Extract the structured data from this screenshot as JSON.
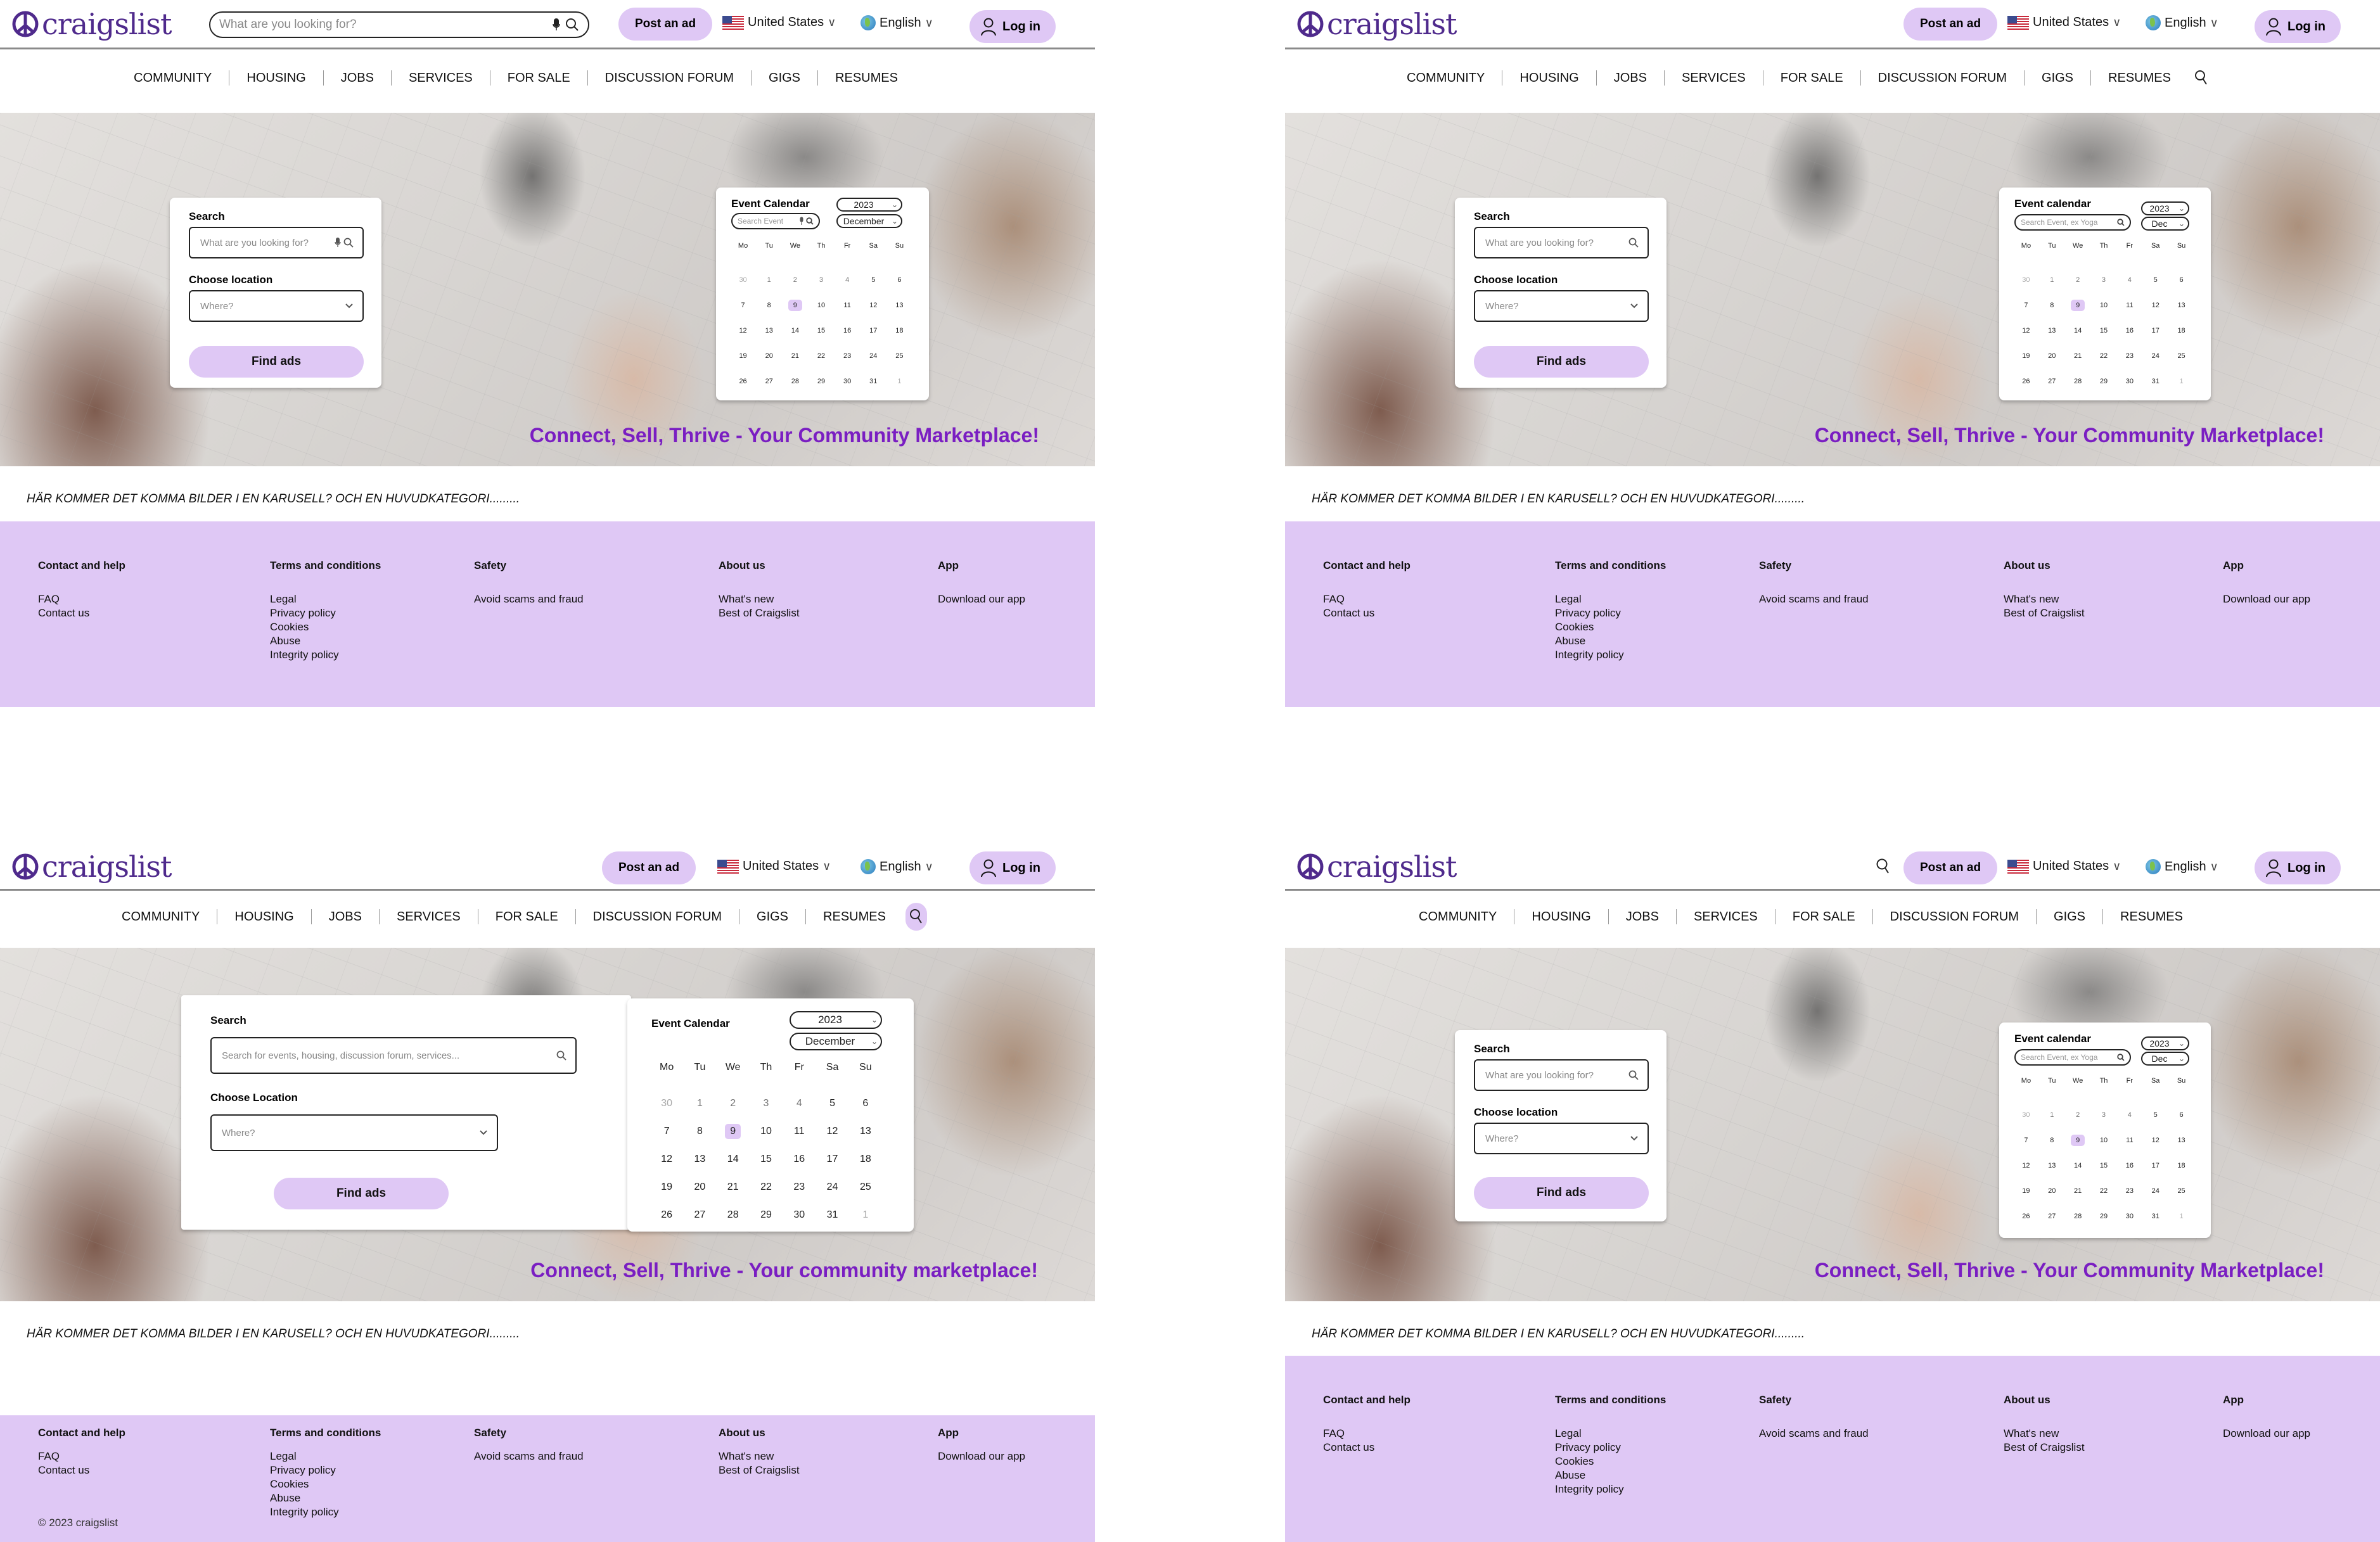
{
  "brand": {
    "name": "craigslist",
    "color": "#4f2a8c",
    "accent": "#dfc8f5",
    "tagline_color": "#7a1ec2"
  },
  "header": {
    "search_placeholder": "What are you looking for?",
    "post_ad": "Post an ad",
    "country": "United States",
    "language": "English",
    "login": "Log in"
  },
  "nav": [
    "COMMUNITY",
    "HOUSING",
    "JOBS",
    "SERVICES",
    "FOR SALE",
    "DISCUSSION FORUM",
    "GIGS",
    "RESUMES"
  ],
  "search_card": {
    "search_label": "Search",
    "search_placeholder": "What are you looking for?",
    "search_placeholder_long": "Search for events, housing, discussion forum, services...",
    "location_label": "Choose location",
    "location_label_alt": "Choose Location",
    "location_placeholder": "Where?",
    "find_button": "Find ads"
  },
  "calendar": {
    "title": "Event Calendar",
    "title_alt": "Event calendar",
    "year": "2023",
    "month": "December",
    "month_short": "Dec",
    "search_placeholder_short": "Search Event",
    "search_placeholder_long": "Search Event, ex Yoga",
    "weekdays": [
      "Mo",
      "Tu",
      "We",
      "Th",
      "Fr",
      "Sa",
      "Su"
    ],
    "weeks": [
      [
        {
          "d": "30",
          "s": "muted"
        },
        {
          "d": "1",
          "s": "dim"
        },
        {
          "d": "2",
          "s": "dim"
        },
        {
          "d": "3",
          "s": "dim"
        },
        {
          "d": "4",
          "s": "dim"
        },
        {
          "d": "5",
          "s": ""
        },
        {
          "d": "6",
          "s": ""
        }
      ],
      [
        {
          "d": "7",
          "s": ""
        },
        {
          "d": "8",
          "s": ""
        },
        {
          "d": "9",
          "s": "sel"
        },
        {
          "d": "10",
          "s": ""
        },
        {
          "d": "11",
          "s": ""
        },
        {
          "d": "12",
          "s": ""
        },
        {
          "d": "13",
          "s": ""
        }
      ],
      [
        {
          "d": "12",
          "s": ""
        },
        {
          "d": "13",
          "s": ""
        },
        {
          "d": "14",
          "s": ""
        },
        {
          "d": "15",
          "s": ""
        },
        {
          "d": "16",
          "s": ""
        },
        {
          "d": "17",
          "s": ""
        },
        {
          "d": "18",
          "s": ""
        }
      ],
      [
        {
          "d": "19",
          "s": ""
        },
        {
          "d": "20",
          "s": ""
        },
        {
          "d": "21",
          "s": ""
        },
        {
          "d": "22",
          "s": ""
        },
        {
          "d": "23",
          "s": ""
        },
        {
          "d": "24",
          "s": ""
        },
        {
          "d": "25",
          "s": ""
        }
      ],
      [
        {
          "d": "26",
          "s": ""
        },
        {
          "d": "27",
          "s": ""
        },
        {
          "d": "28",
          "s": ""
        },
        {
          "d": "29",
          "s": ""
        },
        {
          "d": "30",
          "s": ""
        },
        {
          "d": "31",
          "s": ""
        },
        {
          "d": "1",
          "s": "muted"
        }
      ]
    ],
    "selected_day": "9"
  },
  "hero": {
    "tagline": "Connect, Sell, Thrive - Your Community Marketplace!",
    "tagline_alt": "Connect, Sell, Thrive - Your community marketplace!"
  },
  "carousel_note": "HÄR KOMMER DET KOMMA BILDER I EN KARUSELL? OCH EN HUVUDKATEGORI.........",
  "footer": {
    "columns": [
      {
        "title": "Contact and help",
        "links": [
          "FAQ",
          "Contact us"
        ]
      },
      {
        "title": "Terms and conditions",
        "links": [
          "Legal",
          "Privacy policy",
          "Cookies",
          "Abuse",
          "Integrity policy"
        ]
      },
      {
        "title": "Safety",
        "links": [
          "Avoid scams and fraud"
        ]
      },
      {
        "title": "About us",
        "links": [
          "What's new",
          "Best of Craigslist"
        ]
      },
      {
        "title": "App",
        "links": [
          "Download our app"
        ]
      }
    ],
    "copyright": "© 2023 craigslist"
  }
}
